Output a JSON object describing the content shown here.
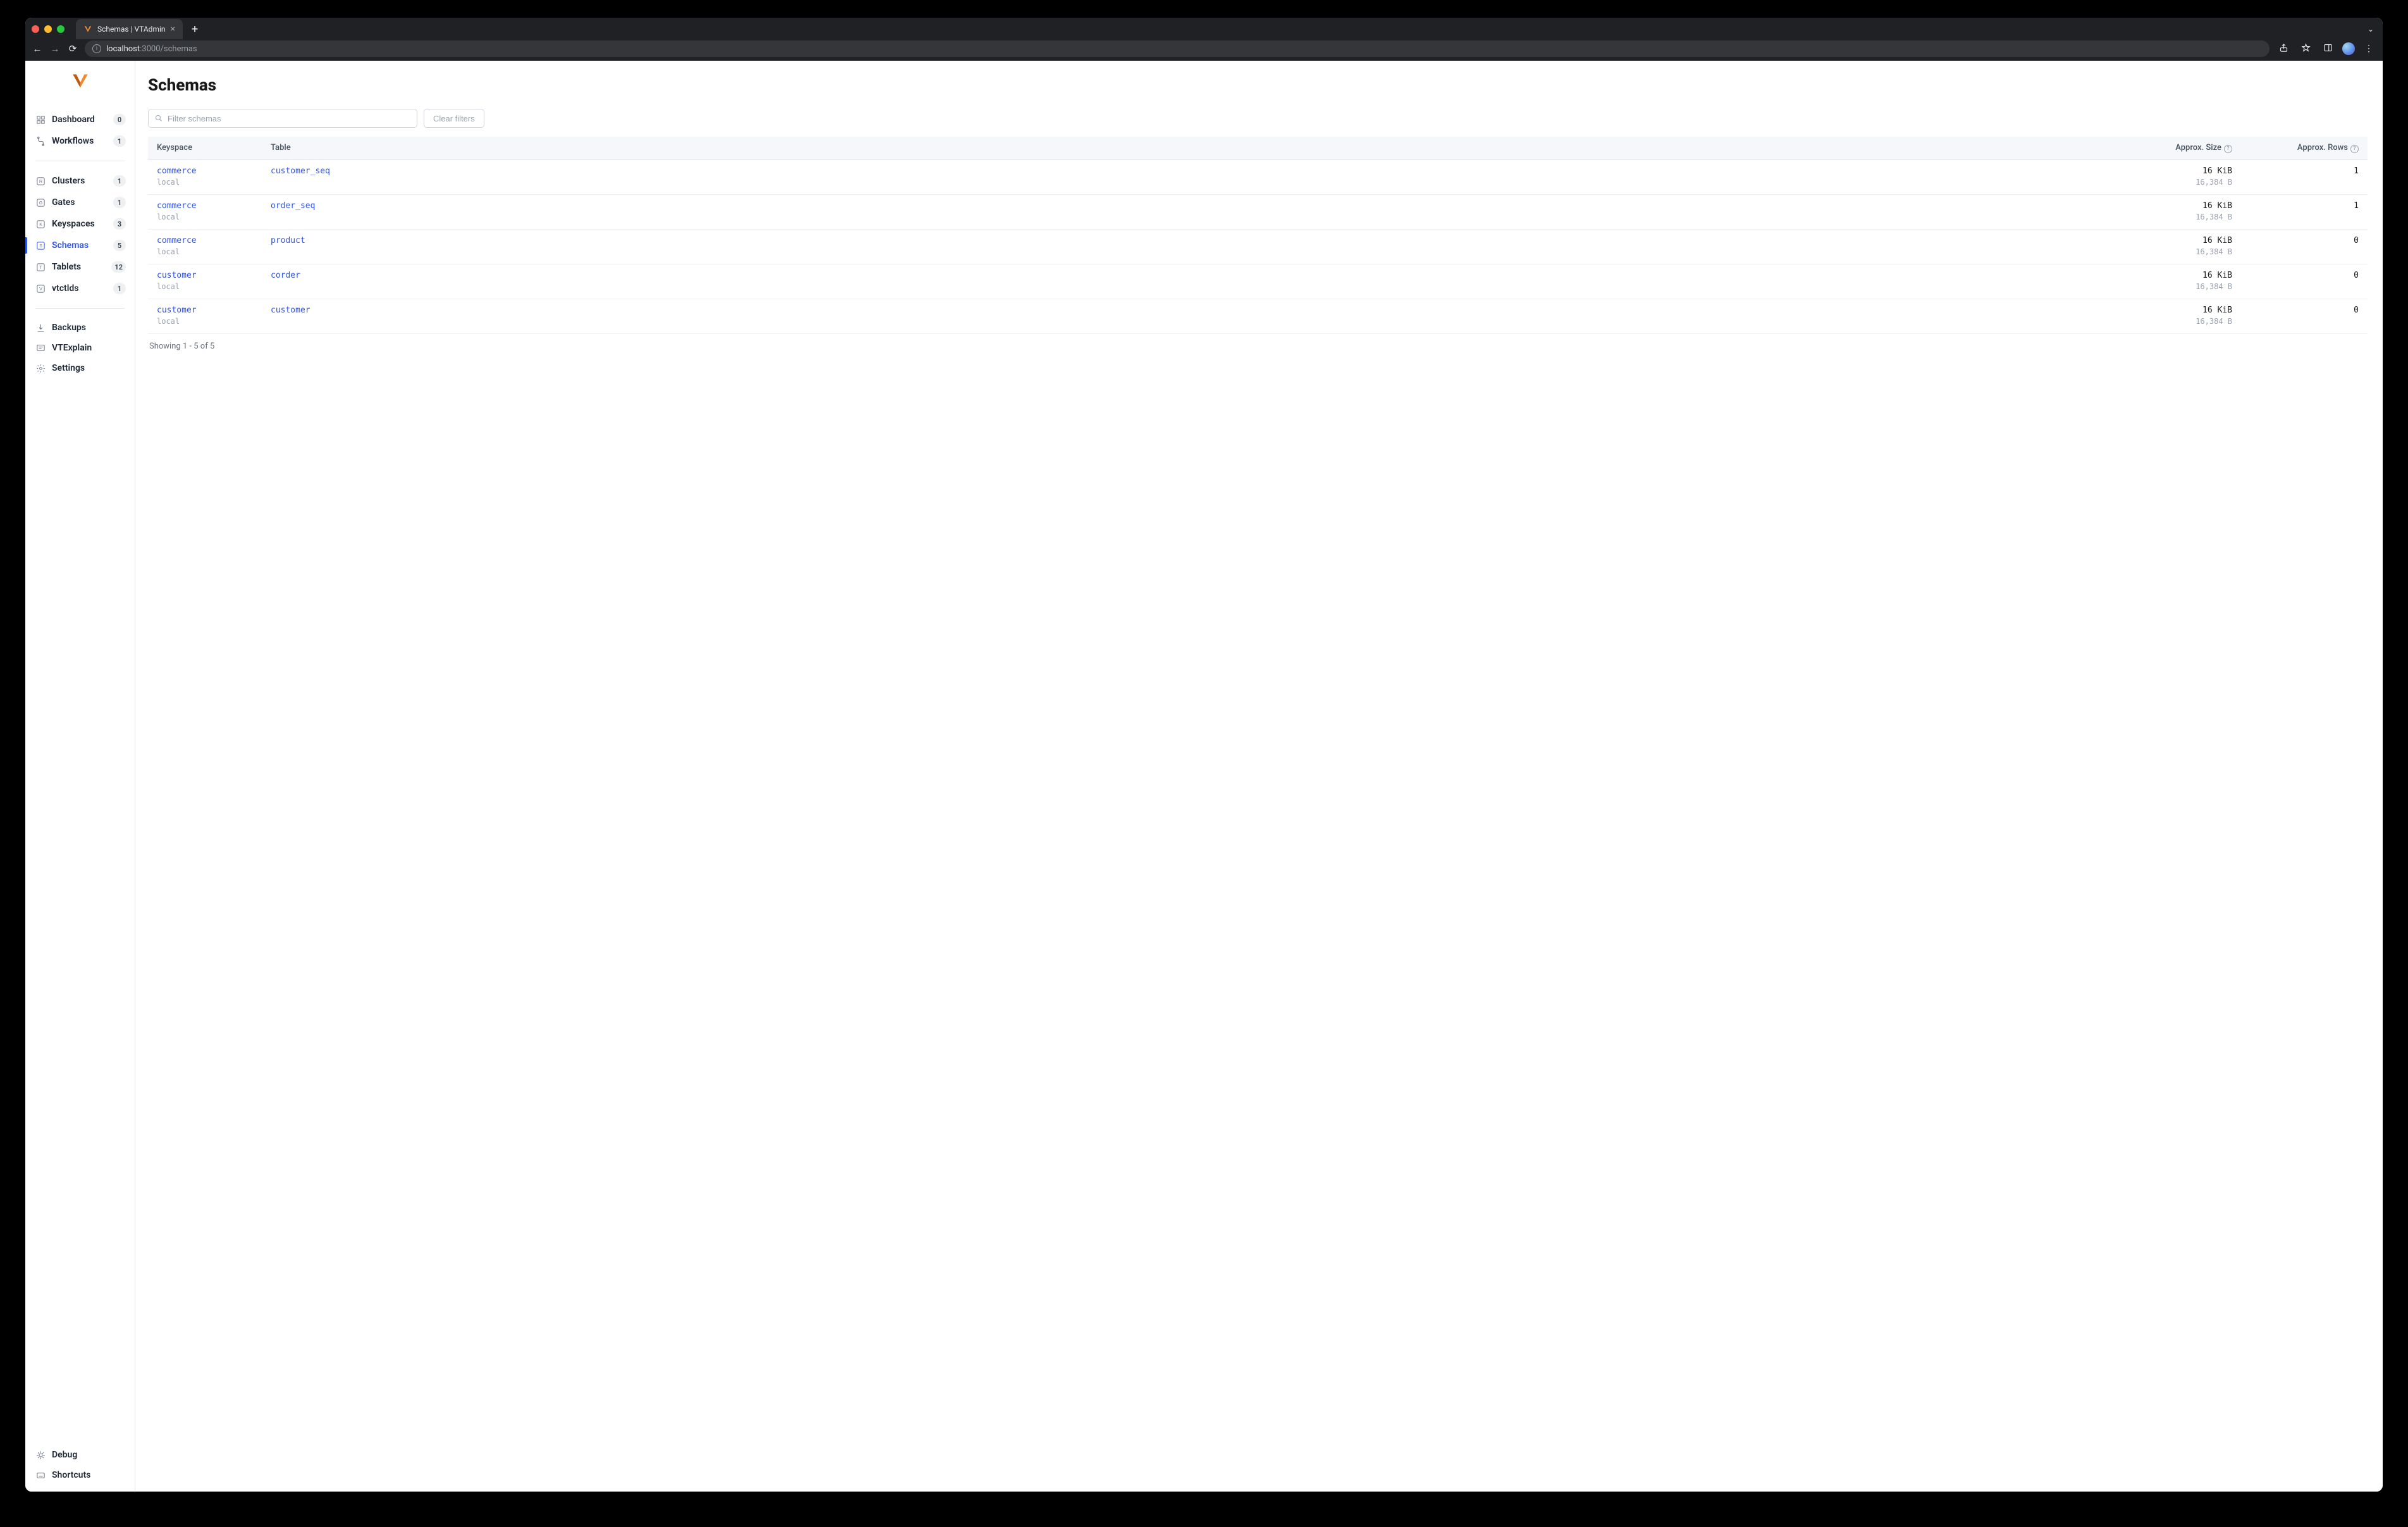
{
  "browser": {
    "tab_title": "Schemas | VTAdmin",
    "url_host": "localhost",
    "url_port_path": ":3000/schemas"
  },
  "sidebar": {
    "groups": [
      [
        {
          "id": "dashboard",
          "label": "Dashboard",
          "badge": "0",
          "icon": "dashboard"
        },
        {
          "id": "workflows",
          "label": "Workflows",
          "badge": "1",
          "icon": "workflows"
        }
      ],
      [
        {
          "id": "clusters",
          "label": "Clusters",
          "badge": "1",
          "icon": "R"
        },
        {
          "id": "gates",
          "label": "Gates",
          "badge": "1",
          "icon": "G"
        },
        {
          "id": "keyspaces",
          "label": "Keyspaces",
          "badge": "3",
          "icon": "K"
        },
        {
          "id": "schemas",
          "label": "Schemas",
          "badge": "5",
          "icon": "S",
          "active": true
        },
        {
          "id": "tablets",
          "label": "Tablets",
          "badge": "12",
          "icon": "T"
        },
        {
          "id": "vtctlds",
          "label": "vtctlds",
          "badge": "1",
          "icon": "V"
        }
      ],
      [
        {
          "id": "backups",
          "label": "Backups",
          "icon": "backups"
        },
        {
          "id": "vtexplain",
          "label": "VTExplain",
          "icon": "vtexplain"
        },
        {
          "id": "settings",
          "label": "Settings",
          "icon": "settings"
        }
      ]
    ],
    "footer": [
      {
        "id": "debug",
        "label": "Debug",
        "icon": "debug"
      },
      {
        "id": "shortcuts",
        "label": "Shortcuts",
        "icon": "shortcuts"
      }
    ]
  },
  "page": {
    "title": "Schemas",
    "search_placeholder": "Filter schemas",
    "clear_filters": "Clear filters",
    "columns": {
      "keyspace": "Keyspace",
      "table": "Table",
      "size": "Approx. Size",
      "rows": "Approx. Rows"
    },
    "rows": [
      {
        "keyspace": "commerce",
        "cluster": "local",
        "table": "customer_seq",
        "size": "16 KiB",
        "size_bytes": "16,384 B",
        "rows": "1"
      },
      {
        "keyspace": "commerce",
        "cluster": "local",
        "table": "order_seq",
        "size": "16 KiB",
        "size_bytes": "16,384 B",
        "rows": "1"
      },
      {
        "keyspace": "commerce",
        "cluster": "local",
        "table": "product",
        "size": "16 KiB",
        "size_bytes": "16,384 B",
        "rows": "0"
      },
      {
        "keyspace": "customer",
        "cluster": "local",
        "table": "corder",
        "size": "16 KiB",
        "size_bytes": "16,384 B",
        "rows": "0"
      },
      {
        "keyspace": "customer",
        "cluster": "local",
        "table": "customer",
        "size": "16 KiB",
        "size_bytes": "16,384 B",
        "rows": "0"
      }
    ],
    "footer": "Showing 1 - 5 of 5"
  }
}
